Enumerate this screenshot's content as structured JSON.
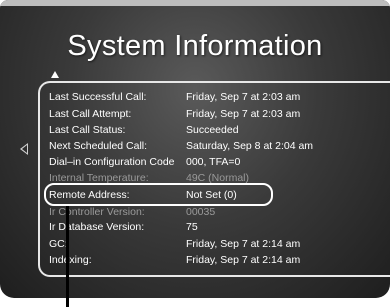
{
  "screen": {
    "title": "System Information"
  },
  "info_rows": [
    {
      "label": "Last Successful Call:",
      "value": "Friday, Sep 7 at 2:03 am"
    },
    {
      "label": "Last Call Attempt:",
      "value": "Friday, Sep 7 at 2:03 am"
    },
    {
      "label": "Last Call Status:",
      "value": "Succeeded"
    },
    {
      "label": "Next Scheduled Call:",
      "value": "Saturday, Sep 8 at 2:04 am"
    },
    {
      "label": "Dial–in Configuration Code",
      "value": "000, TFA=0"
    },
    {
      "label": "Internal Temperature:",
      "value": "49C (Normal)"
    },
    {
      "label": "Remote Address:",
      "value": "Not Set (0)"
    },
    {
      "label": "Ir Controller Version:",
      "value": "00035"
    },
    {
      "label": "Ir Database Version:",
      "value": "75"
    },
    {
      "label": "GC:",
      "value": "Friday, Sep 7 at 2:14 am"
    },
    {
      "label": "Indexing:",
      "value": "Friday, Sep 7 at 2:14 am"
    }
  ],
  "icons": {
    "scroll_up": "up-arrow-icon",
    "back": "left-arrow-icon"
  },
  "colors": {
    "text": "#ffffff",
    "background": "#3a3a3a",
    "highlight": "#ffffff"
  }
}
